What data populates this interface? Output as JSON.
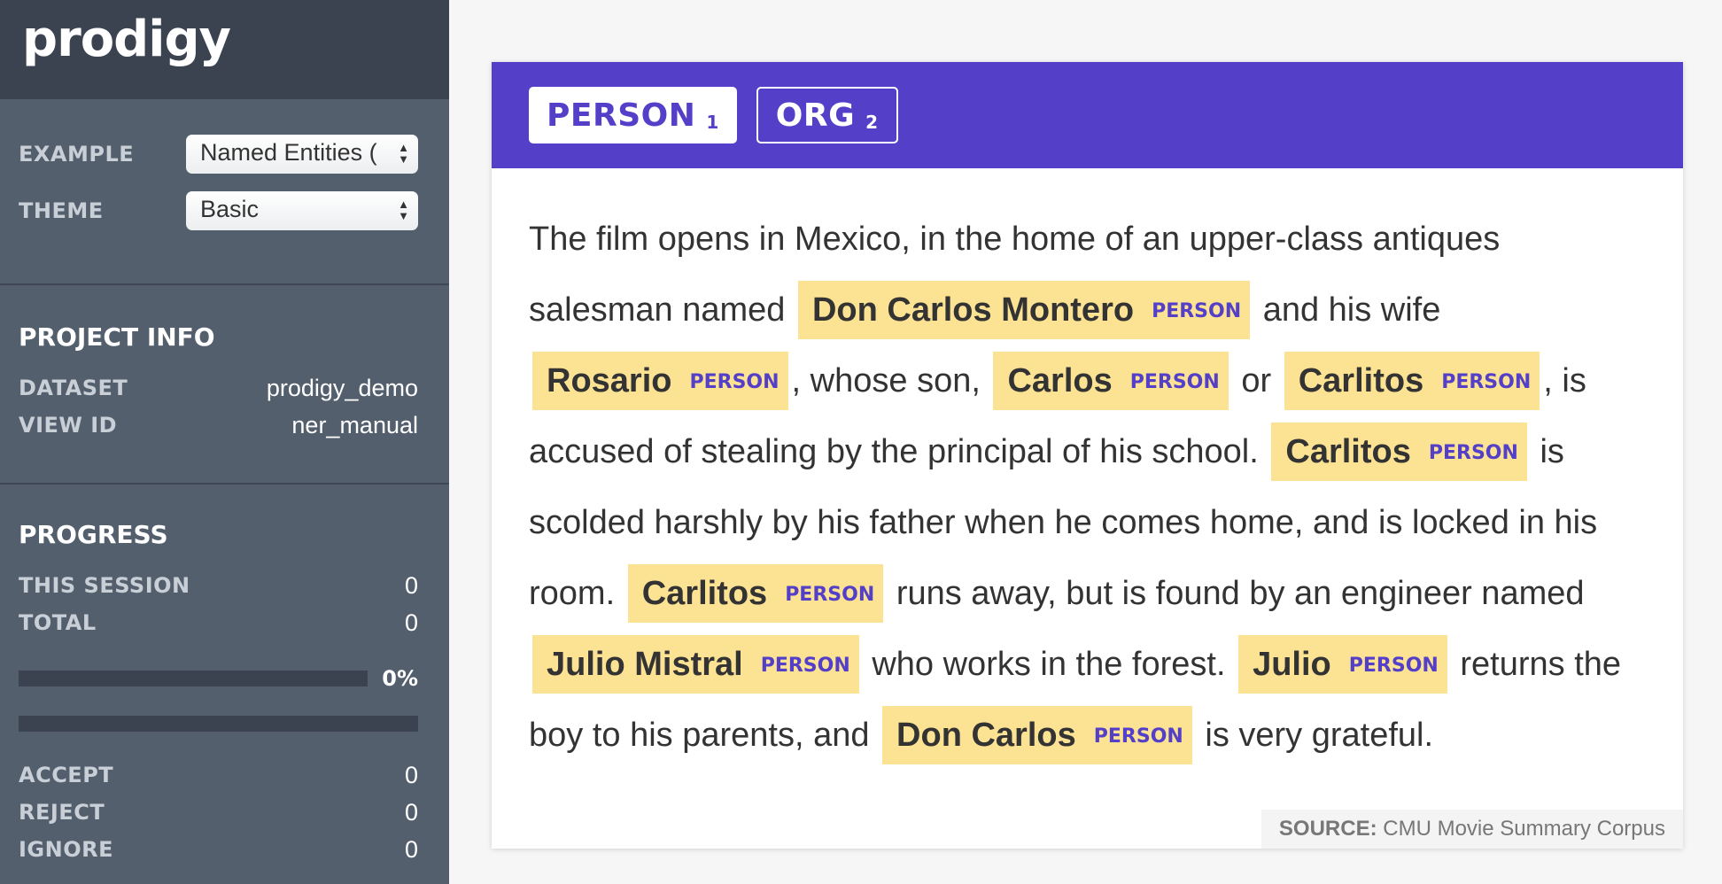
{
  "app": {
    "logo": "prodigy"
  },
  "sidebar": {
    "options": [
      {
        "label": "EXAMPLE",
        "value": "Named Entities ("
      },
      {
        "label": "THEME",
        "value": "Basic"
      }
    ],
    "project_info": {
      "title": "PROJECT INFO",
      "rows": [
        {
          "key": "DATASET",
          "value": "prodigy_demo"
        },
        {
          "key": "VIEW ID",
          "value": "ner_manual"
        }
      ]
    },
    "progress": {
      "title": "PROGRESS",
      "session_label": "THIS SESSION",
      "session_value": "0",
      "total_label": "TOTAL",
      "total_value": "0",
      "percent_text": "0%",
      "percent": 0,
      "counts": [
        {
          "key": "ACCEPT",
          "value": "0"
        },
        {
          "key": "REJECT",
          "value": "0"
        },
        {
          "key": "IGNORE",
          "value": "0"
        }
      ]
    }
  },
  "labels": [
    {
      "name": "PERSON",
      "key": "1",
      "active": true
    },
    {
      "name": "ORG",
      "key": "2",
      "active": false
    }
  ],
  "text": {
    "t0": "The film opens in Mexico, in the home of an upper-class antiques salesman named",
    "e1": "Don Carlos Montero",
    "t1": "and his wife",
    "e2": "Rosario",
    "t2": ", whose son,",
    "e3": "Carlos",
    "t3": "or",
    "e4": "Carlitos",
    "t4": ", is accused of stealing by the principal of his school.",
    "e5": "Carlitos",
    "t5": "is scolded harshly by his father when he comes home, and is locked in his room.",
    "e6": "Carlitos",
    "t6": "runs away, but is found by an engineer named",
    "e7": "Julio Mistral",
    "t7": "who works in the forest.",
    "e8": "Julio",
    "t8": "returns the boy to his parents, and",
    "e9": "Don Carlos",
    "t9": "is very grateful.",
    "tag": "PERSON"
  },
  "source": {
    "label": "SOURCE:",
    "value": "CMU Movie Summary Corpus"
  },
  "colors": {
    "accent": "#5440c8",
    "highlight": "#fce293",
    "sidebar": "#545f6e",
    "sidebar_dark": "#3b4350"
  }
}
